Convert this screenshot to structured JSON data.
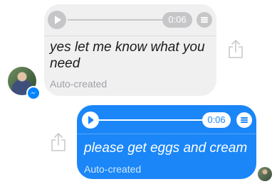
{
  "incoming": {
    "duration": "0:06",
    "transcript": "yes let me know what you need",
    "status": "Auto-created"
  },
  "outgoing": {
    "duration": "0:06",
    "transcript": "please get eggs and cream",
    "status": "Auto-created"
  },
  "icons": {
    "play": "play-icon",
    "menu": "menu-icon",
    "share": "share-icon",
    "messenger_badge": "messenger-icon"
  },
  "colors": {
    "outgoing_bubble": "#1a86f7",
    "incoming_bubble": "#f0f0f1",
    "incoming_controls": "#c6c6c9",
    "secondary_text": "#a1a1a6"
  }
}
